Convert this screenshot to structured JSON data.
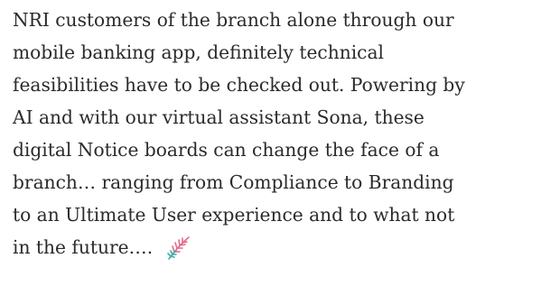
{
  "article": {
    "lines": [
      "NRI customers of the branch alone through our",
      "mobile banking app, definitely technical",
      "feasibilities have to be checked out. Powering by",
      "AI and with our virtual assistant Sona, these",
      "digital Notice boards can change the face of a",
      "branch… ranging from Compliance to Branding",
      "to an Ultimate User experience and to what not",
      "in the future…."
    ],
    "trailing_icon": "leaf-icon"
  }
}
